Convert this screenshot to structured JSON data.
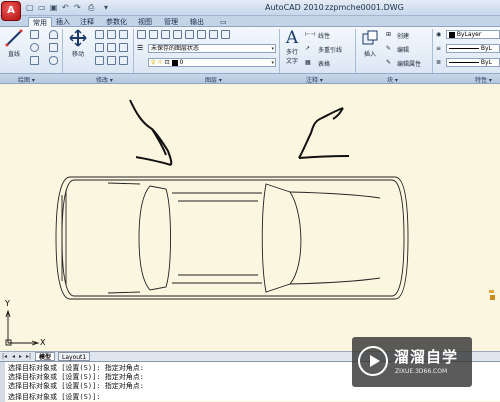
{
  "window": {
    "app_name": "AutoCAD 2010",
    "file_name": "zzpmche0001.DWG",
    "app_button_icon": "autocad-logo-icon"
  },
  "tabs": [
    "常用",
    "插入",
    "注释",
    "参数化",
    "视图",
    "管理",
    "输出"
  ],
  "active_tab": "常用",
  "ribbon": {
    "draw": {
      "line_label": "直线",
      "panel_label": "绘图 ▾"
    },
    "modify": {
      "move_label": "移动",
      "panel_label": "修改 ▾"
    },
    "layers": {
      "layer_state_value": "未保存的图层状态",
      "layer_value": "0",
      "panel_label": "图层 ▾"
    },
    "annotation": {
      "mtext_label_1": "多行",
      "mtext_label_2": "文字",
      "linear_label": "线性",
      "multileader_label": "多重引线",
      "table_label": "表格",
      "panel_label": "注释 ▾"
    },
    "block": {
      "insert_label": "插入",
      "create_label": "创建",
      "edit_label": "编辑",
      "edit_attributes_label": "编辑属性",
      "panel_label": "块 ▾"
    },
    "properties": {
      "color_value": "ByLayer",
      "linetype_value": "ByL",
      "lineweight_value": "ByL",
      "panel_label": "特性 ▾"
    }
  },
  "layout_tabs": [
    "模型",
    "Layout1"
  ],
  "active_layout": "模型",
  "ucs": {
    "y_label": "Y",
    "x_label": "X"
  },
  "command_lines": [
    "选择目标对象或 [设置(S)]: 指定对角点:",
    "选择目标对象或 [设置(S)]: 指定对角点:",
    "选择目标对象或 [设置(S)]: 指定对角点:",
    "选择目标对象或 [设置(S)]:"
  ],
  "watermark": {
    "title": "溜溜自学",
    "url": "ZIXUE.3D66.COM"
  },
  "colors": {
    "canvas_background": "#fbf6e0",
    "ribbon_background": "#dce7f4",
    "app_button": "#c81818"
  }
}
